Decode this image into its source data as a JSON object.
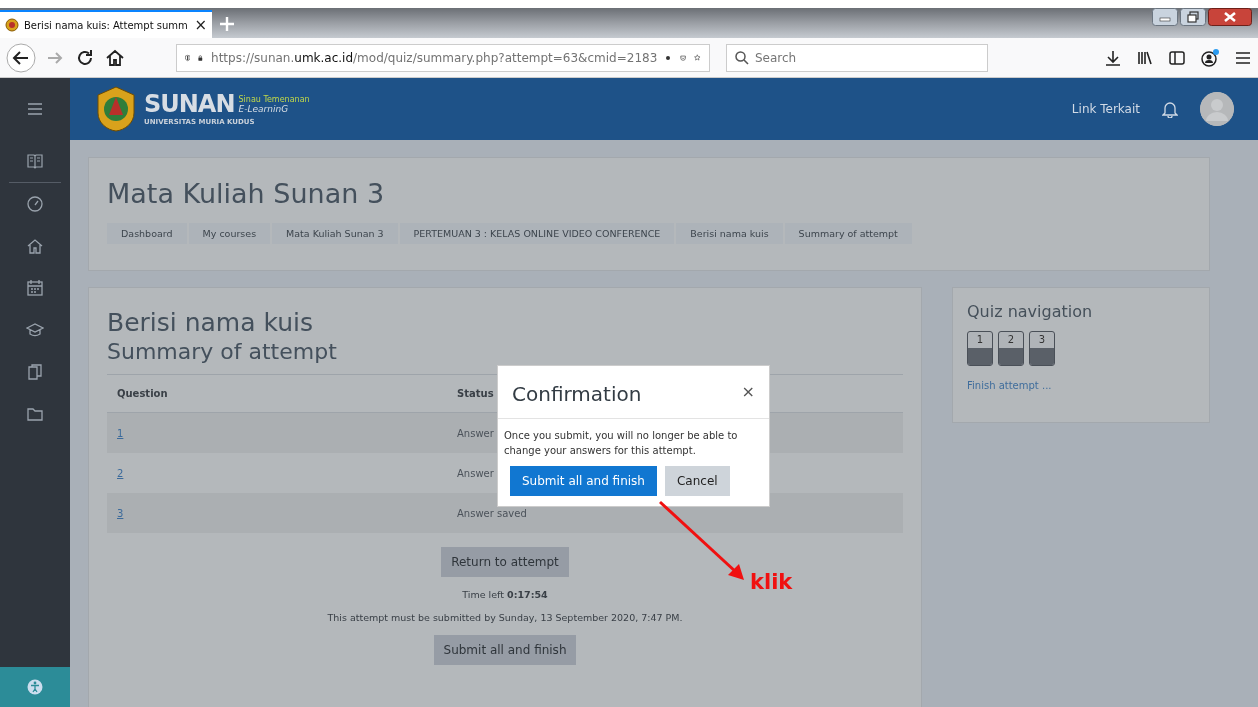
{
  "browser": {
    "tab_title": "Berisi nama kuis: Attempt summ",
    "tab_close": "×",
    "url": "https://sunan.**umk.ac.id**/mod/quiz/summary.php?attempt=63&cmid=2183",
    "search_placeholder": "Search"
  },
  "site_header": {
    "brand": "SUNAN",
    "tagline": "Sinau Temenanan",
    "product": "E-LearninG",
    "university": "UNIVERSITAS MURIA KUDUS",
    "nav_link": "Link Terkait"
  },
  "course": {
    "title": "Mata Kuliah Sunan 3",
    "breadcrumb": [
      "Dashboard",
      "My courses",
      "Mata Kuliah Sunan 3",
      "PERTEMUAN 3 : KELAS ONLINE VIDEO CONFERENCE",
      "Berisi nama kuis",
      "Summary of attempt"
    ]
  },
  "quiz": {
    "title": "Berisi nama kuis",
    "heading": "Summary of attempt",
    "columns": [
      "Question",
      "Status"
    ],
    "rows": [
      {
        "question": "1",
        "status": "Answer"
      },
      {
        "question": "2",
        "status": "Answer"
      },
      {
        "question": "3",
        "status": "Answer saved"
      }
    ],
    "return_button": "Return to attempt",
    "time_left": "Time left **0:17:54**",
    "deadline": "This attempt must be submitted by Sunday, 13 September 2020, 7:47 PM.",
    "submit_button": "Submit all and finish"
  },
  "quiz_navigation": {
    "title": "Quiz navigation",
    "questions": [
      {
        "label": "1",
        "answered": true
      },
      {
        "label": "2",
        "answered": true
      },
      {
        "label": "3",
        "answered": true
      }
    ],
    "finish_link": "Finish attempt ..."
  },
  "modal": {
    "title": "Confirmation",
    "close": "×",
    "message": "Once you submit, you will no longer be able to change your answers for this attempt.",
    "buttons": [
      {
        "label": "Submit all and finish",
        "kind": "primary"
      },
      {
        "label": "Cancel",
        "kind": "secondary"
      }
    ]
  },
  "annotation": {
    "text": "klik"
  }
}
